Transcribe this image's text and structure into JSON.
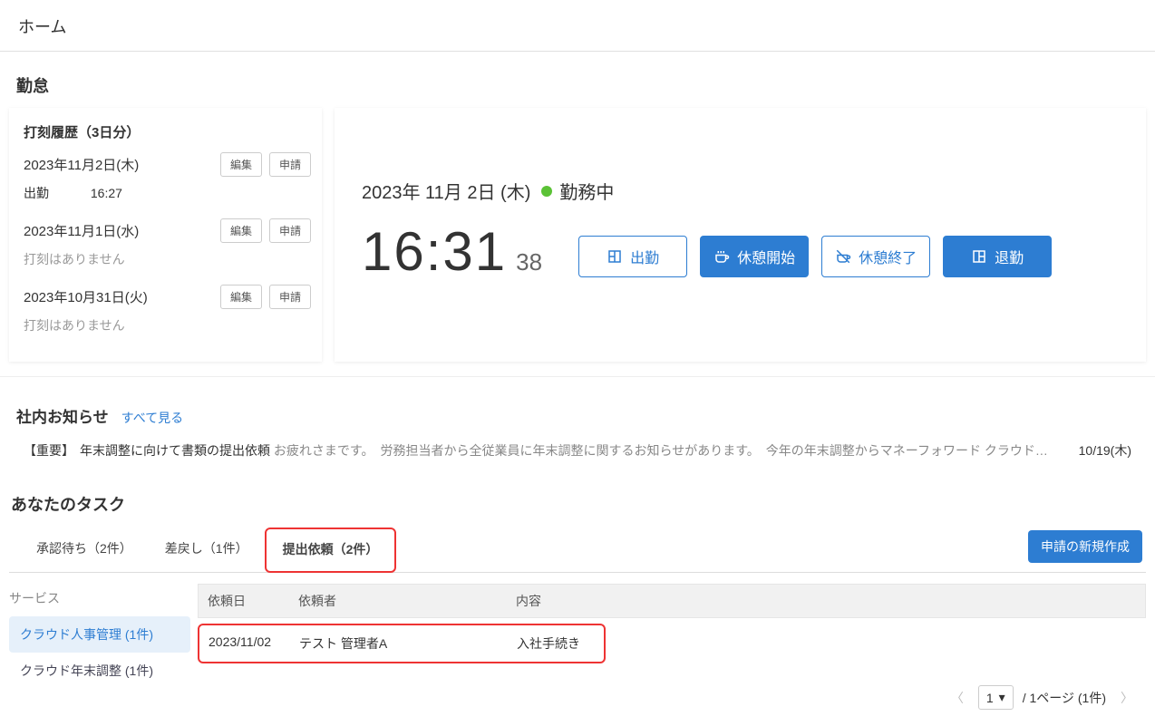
{
  "page_title": "ホーム",
  "kintai": {
    "section_title": "勤怠",
    "history_title": "打刻履歴（3日分）",
    "entries": [
      {
        "date": "2023年11月2日(木)",
        "status": "出勤",
        "time": "16:27",
        "has_record": true
      },
      {
        "date": "2023年11月1日(水)",
        "no_record": "打刻はありません",
        "has_record": false
      },
      {
        "date": "2023年10月31日(火)",
        "no_record": "打刻はありません",
        "has_record": false
      }
    ],
    "edit_label": "編集",
    "apply_label": "申請",
    "clock": {
      "date_text": "2023年 11月 2日 (木)",
      "status_text": "勤務中",
      "time_hm": "16:31",
      "time_s": "38",
      "btn_clockin": "出勤",
      "btn_breakstart": "休憩開始",
      "btn_breakend": "休憩終了",
      "btn_clockout": "退勤"
    }
  },
  "announce": {
    "title": "社内お知らせ",
    "see_all": "すべて見る",
    "item_tag": "【重要】",
    "item_title": "年末調整に向けて書類の提出依頼",
    "item_body": "お疲れさまです。　労務担当者から全従業員に年末調整に関するお知らせがあります。　今年の年末調整からマネーフォワード クラウド年末調整を導入…",
    "item_date": "10/19(木)"
  },
  "tasks": {
    "title": "あなたのタスク",
    "tabs": {
      "pending": "承認待ち（2件）",
      "returned": "差戻し（1件）",
      "request": "提出依頼（2件）"
    },
    "new_request": "申請の新規作成",
    "service_label": "サービス",
    "services": {
      "hr": "クラウド人事管理 (1件)",
      "year": "クラウド年末調整 (1件)"
    },
    "columns": {
      "c1": "依頼日",
      "c2": "依頼者",
      "c3": "内容"
    },
    "rows": [
      {
        "c1": "2023/11/02",
        "c2": "テスト 管理者A",
        "c3": "入社手続き"
      }
    ],
    "pager": {
      "current": "1",
      "text": "/ 1ページ (1件)"
    }
  }
}
